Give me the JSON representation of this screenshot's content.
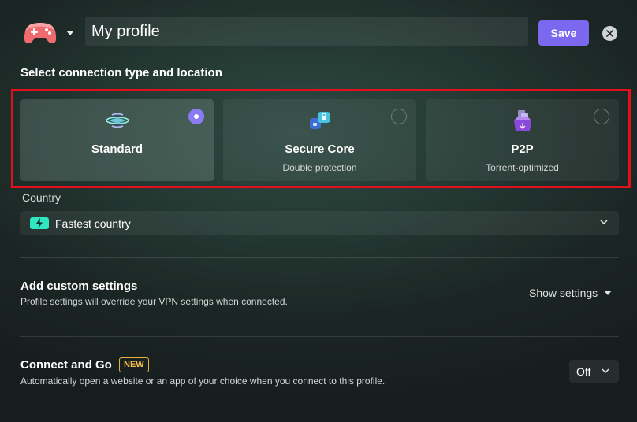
{
  "header": {
    "profile_name": "My profile",
    "save_label": "Save",
    "profile_icon": "gamepad-icon",
    "close_icon": "close-icon"
  },
  "connection": {
    "title": "Select connection type and location",
    "cards": [
      {
        "title": "Standard",
        "subtitle": "",
        "icon": "globe-icon",
        "selected": true
      },
      {
        "title": "Secure Core",
        "subtitle": "Double protection",
        "icon": "secure-core-icon",
        "selected": false
      },
      {
        "title": "P2P",
        "subtitle": "Torrent-optimized",
        "icon": "p2p-icon",
        "selected": false
      }
    ]
  },
  "country": {
    "label": "Country",
    "value": "Fastest country",
    "icon": "bolt-icon"
  },
  "custom_settings": {
    "title": "Add custom settings",
    "description": "Profile settings will override your VPN settings when connected.",
    "toggle_label": "Show settings"
  },
  "connect_and_go": {
    "title": "Connect and Go",
    "badge": "NEW",
    "description": "Automatically open a website or an app of your choice when you connect to this profile.",
    "value": "Off"
  },
  "colors": {
    "accent": "#7b68ee",
    "highlight_border": "#e3101c",
    "bolt_badge": "#2ee6c0",
    "new_badge": "#e6b23c"
  }
}
